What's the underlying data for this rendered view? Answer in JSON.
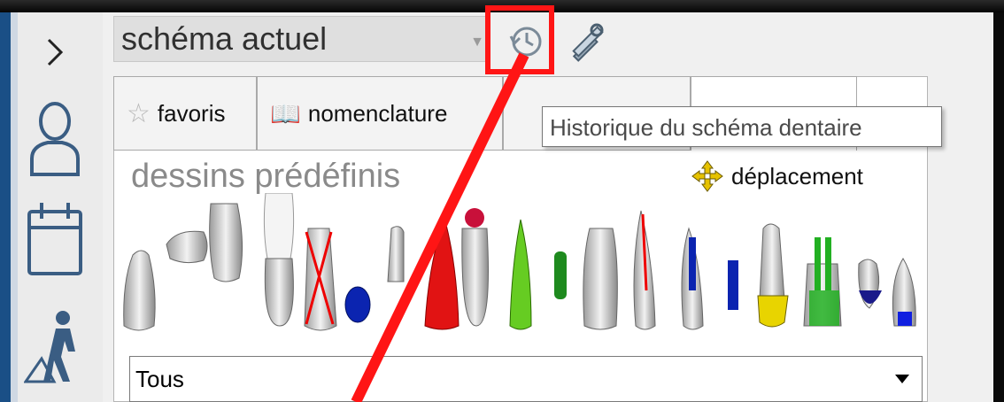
{
  "schema": {
    "selected": "schéma actuel"
  },
  "toolbar": {
    "history_tooltip": "Historique du schéma dentaire"
  },
  "tabs": [
    {
      "label": "favoris",
      "icon": "star-icon"
    },
    {
      "label": "nomenclature",
      "icon": "book-icon"
    }
  ],
  "panel": {
    "title": "dessins prédéfinis",
    "move_label": "déplacement"
  },
  "filter": {
    "selected": "Tous"
  },
  "colors": {
    "highlight": "#ff1515",
    "accent": "#1a4f86"
  }
}
